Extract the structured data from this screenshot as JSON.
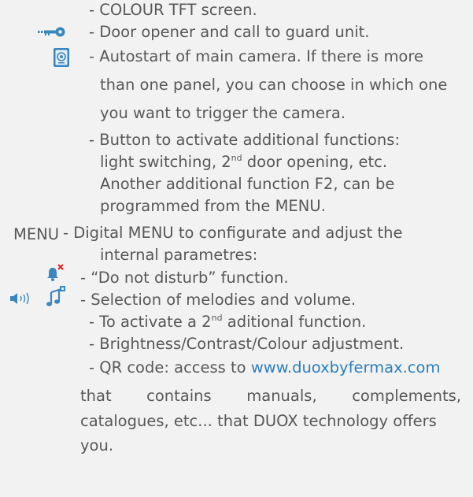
{
  "items": {
    "tft": "- COLOUR TFT screen.",
    "door": "- Door opener and call to guard unit.",
    "autostart": [
      "- Autostart of main camera. If there is more",
      "than one panel, you can choose in which one",
      "you want to trigger the camera."
    ],
    "functions": {
      "l1": "- Button to activate additional functions:",
      "l2a": "light switching, 2",
      "l2sup": "nd",
      "l2b": " door opening, etc.",
      "l3": "Another additional function F2, can be",
      "l4": "programmed from the MENU."
    },
    "menu_label": "MENU",
    "menu": [
      "- Digital MENU to configurate and adjust the",
      "internal parametres:"
    ],
    "dnd": "- “Do not disturb” function.",
    "melodies": "- Selection of melodies and volume.",
    "second_func": {
      "a": "- To activate a 2",
      "sup": "nd",
      "b": " aditional function."
    },
    "brightness": "-  Brightness/Contrast/Colour adjustment.",
    "qr": {
      "prefix": "- QR code: access to ",
      "link": "www.duoxbyfermax.com",
      "l2": "that contains manuals, complements,",
      "l3": "catalogues, etc... that DUOX technology offers",
      "l4": "you."
    }
  },
  "icons": {
    "key": "key-icon",
    "camera": "camera-icon",
    "bell": "bell-mute-icon",
    "speaker": "speaker-volume-icon",
    "note": "music-note-icon"
  },
  "colors": {
    "text": "#585858",
    "link": "#2a7fbf",
    "icon_blue": "#3a86c0",
    "mute_red": "#e02020",
    "background": "#f2f2f2"
  }
}
